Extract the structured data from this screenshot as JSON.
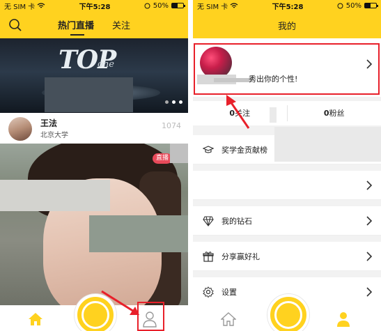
{
  "status_bar": {
    "carrier": "无 SIM 卡",
    "time": "下午5:28",
    "battery": "50%",
    "battery_level": 0.5
  },
  "left_screen": {
    "tabs": {
      "hot": "热门直播",
      "follow": "关注"
    },
    "banner": {
      "logo": "TOP",
      "logo_sub": "one"
    },
    "streamer": {
      "name": "王法",
      "school": "北京大学",
      "viewers": "1074"
    },
    "live_badge": "直播",
    "tabbar": {
      "home_icon": "home-icon",
      "record_icon": "record-icon",
      "me_icon": "person-icon"
    }
  },
  "right_screen": {
    "title": "我的",
    "profile": {
      "signature": "秀出你的个性!"
    },
    "stats": {
      "follow_count": "0",
      "follow_label": "关注",
      "fans_count": "0",
      "fans_label": "粉丝"
    },
    "menu": [
      {
        "label": "奖学金贡献榜",
        "icon": "graduation-cap-icon"
      },
      {
        "label": "",
        "icon": ""
      },
      {
        "label": "我的钻石",
        "icon": "diamond-icon"
      },
      {
        "label": "分享赢好礼",
        "icon": "gift-icon"
      },
      {
        "label": "设置",
        "icon": "gear-icon"
      }
    ],
    "tabbar": {
      "home_icon": "home-icon",
      "record_icon": "record-icon",
      "me_icon": "person-icon"
    }
  },
  "colors": {
    "accent": "#ffd21f",
    "highlight": "#e8202a",
    "live_badge": "#e84a5a"
  }
}
